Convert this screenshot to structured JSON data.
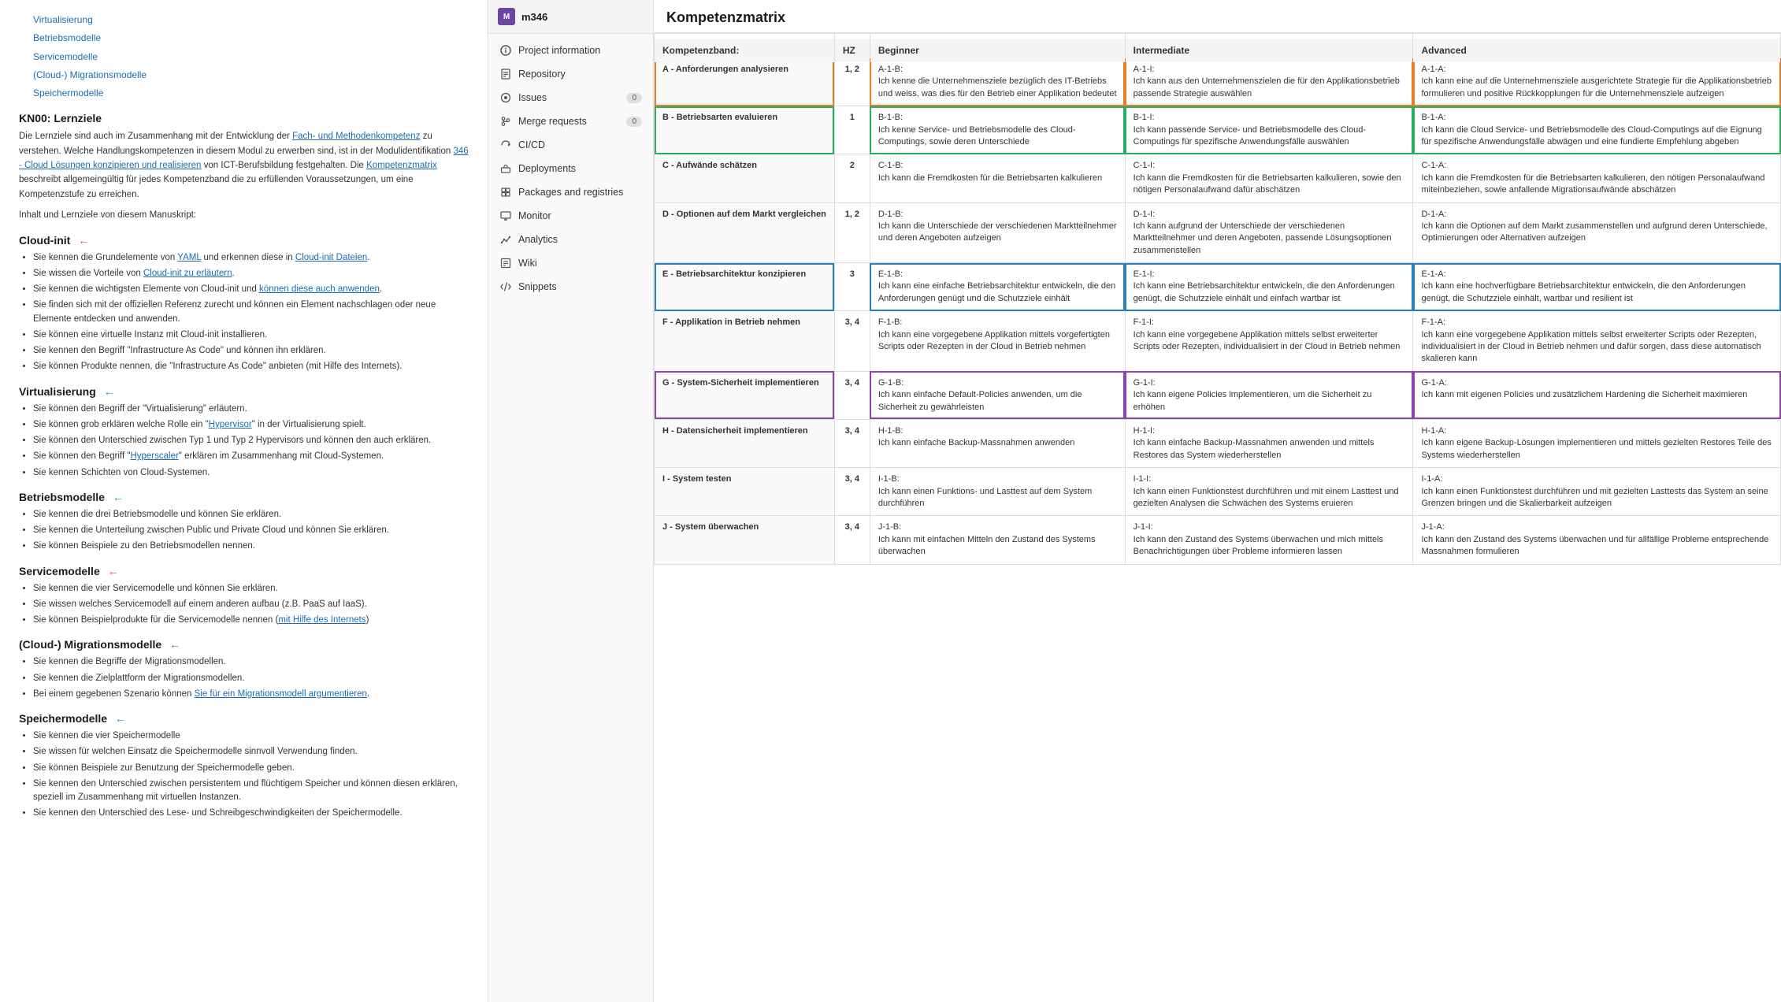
{
  "left_panel": {
    "toc": [
      {
        "label": "Virtualisierung"
      },
      {
        "label": "Betriebsmodelle"
      },
      {
        "label": "Servicemodelle"
      },
      {
        "label": "(Cloud-) Migrationsmodelle"
      },
      {
        "label": "Speichermodelle"
      }
    ],
    "sections": [
      {
        "id": "kn00",
        "title": "KN00: Lernziele",
        "intro": "Die Lernziele sind auch im Zusammenhang mit der Entwicklung der Fach- und Methodenkompetenz zu verstehen. Welche Handlungskompetenzen in diesem Modul zu erwerben sind, ist in der Modulidentifikation 346 - Cloud Lösungen konzipieren und realisieren von ICT-Berufsbildung festgehalten. Die Kompetenzmatrix beschreibt allgemeingültig für jedes Kompetenzband die zu erfüllenden Voraussetzungen, um eine Kompetenzstufe zu erreichen.",
        "subtext": "Inhalt und Lernziele von diesem Manuskript:"
      },
      {
        "id": "cloudinit",
        "title": "Cloud-init",
        "items": [
          "Sie kennen die Grundelemente von YAML und erkennen diese in Cloud-init Dateien.",
          "Sie wissen die Vorteile von Cloud-init zu erläutern.",
          "Sie kennen die wichtigsten Elemente von Cloud-init und können diese auch anwenden.",
          "Sie finden sich mit der offiziellen Referenz zurecht und können ein Element nachschlagen oder neue Elemente entdecken und anwenden.",
          "Sie können eine virtuelle Instanz mit Cloud-init installieren.",
          "Sie kennen den Begriff \"Infrastructure As Code\" und können ihn erklären.",
          "Sie können Produkte nennen, die \"Infrastructure As Code\" anbieten (mit Hilfe des Internets)."
        ]
      },
      {
        "id": "virtualisierung",
        "title": "Virtualisierung",
        "items": [
          "Sie können den Begriff der \"Virtualisierung\" erläutern.",
          "Sie können grob erklären welche Rolle ein \"Hypervisor\" in der Virtualisierung spielt.",
          "Sie können den Unterschied zwischen Typ 1 und Typ 2 Hypervisors und können den auch erklären.",
          "Sie können den Begriff \"Hyperscaler\" erklären im Zusammenhang mit Cloud-Systemen.",
          "Sie kennen Schichten von Cloud-Systemen."
        ]
      },
      {
        "id": "betriebsmodelle",
        "title": "Betriebsmodelle",
        "items": [
          "Sie kennen die drei Betriebsmodelle und können Sie erklären.",
          "Sie kennen die Unterteilung zwischen Public und Private Cloud und können Sie erklären.",
          "Sie können Beispiele zu den Betriebsmodellen nennen."
        ]
      },
      {
        "id": "servicemodelle",
        "title": "Servicemodelle",
        "items": [
          "Sie kennen die vier Servicemodelle und können Sie erklären.",
          "Sie wissen welches Servicemodell auf einem anderen aufbau (z.B. PaaS auf IaaS).",
          "Sie können Beispielprodukte für die Servicemodelle nennen (mit Hilfe des Internets)"
        ]
      },
      {
        "id": "migrationsmodelle",
        "title": "(Cloud-) Migrationsmodelle",
        "items": [
          "Sie kennen die Begriffe der Migrationsmodellen.",
          "Sie kennen die Zielplattform der Migrationsmodellen.",
          "Bei einem gegebenen Szenario können Sie für ein Migrationsmodell argumentieren."
        ]
      },
      {
        "id": "speichermodelle",
        "title": "Speichermodelle",
        "items": [
          "Sie kennen die vier Speichermodelle",
          "Sie wissen für welchen Einsatz die Speichermodelle sinnvoll Verwendung finden.",
          "Sie können Beispiele zur Benutzung der Speichermodelle geben.",
          "Sie kennen den Unterschied zwischen persistentem und flüchtigem Speicher und können diesen erklären, speziell im Zusammenhang mit virtuellen Instanzen.",
          "Sie kennen den Unterschied des Lese- und Schreibgeschwindigkeiten der Speichermodelle."
        ]
      }
    ]
  },
  "sidebar": {
    "project_icon": "M",
    "project_name": "m346",
    "items": [
      {
        "label": "Project information",
        "icon": "info",
        "active": false
      },
      {
        "label": "Repository",
        "icon": "repo",
        "active": false
      },
      {
        "label": "Issues",
        "icon": "issues",
        "active": false,
        "badge": "0"
      },
      {
        "label": "Merge requests",
        "icon": "merge",
        "active": false,
        "badge": "0"
      },
      {
        "label": "CI/CD",
        "icon": "cicd",
        "active": false
      },
      {
        "label": "Deployments",
        "icon": "deploy",
        "active": false
      },
      {
        "label": "Packages and registries",
        "icon": "packages",
        "active": false
      },
      {
        "label": "Monitor",
        "icon": "monitor",
        "active": false
      },
      {
        "label": "Analytics",
        "icon": "analytics",
        "active": false
      },
      {
        "label": "Wiki",
        "icon": "wiki",
        "active": false
      },
      {
        "label": "Snippets",
        "icon": "snippets",
        "active": false
      }
    ]
  },
  "matrix": {
    "title": "Kompetenzmatrix",
    "columns": [
      "Kompetenzband:",
      "HZ",
      "Beginner",
      "Intermediate",
      "Advanced"
    ],
    "rows": [
      {
        "band": "A - Anforderungen analysieren",
        "hz": "1, 2",
        "beginner": "A-1-B:\nIch kenne die Unternehmensziele bezüglich des IT-Betriebs und weiss, was dies für den Betrieb einer Applikation bedeutet",
        "intermediate": "A-1-I:\nIch kann aus den Unternehmenszielen die für den Applikationsbetrieb passende Strategie auswählen",
        "advanced": "A-1-A:\nIch kann eine auf die Unternehmensziele ausgerichtete Strategie für die Applikationsbetrieb formulieren und positive Rückkopplungen für die Unternehmensziele aufzeigen",
        "highlight": "orange"
      },
      {
        "band": "B - Betriebsarten evaluieren",
        "hz": "1",
        "beginner": "B-1-B:\nIch kenne Service- und Betriebsmodelle des Cloud-Computings, sowie deren Unterschiede",
        "intermediate": "B-1-I:\nIch kann passende Service- und Betriebsmodelle des Cloud-Computings für spezifische Anwendungsfälle auswählen",
        "advanced": "B-1-A:\nIch kann die Cloud Service- und Betriebsmodelle des Cloud-Computings auf die Eignung für spezifische Anwendungsfälle abwägen und eine fundierte Empfehlung abgeben",
        "highlight": "green"
      },
      {
        "band": "C - Aufwände schätzen",
        "hz": "2",
        "beginner": "C-1-B:\nIch kann die Fremdkosten für die Betriebsarten kalkulieren",
        "intermediate": "C-1-I:\nIch kann die Fremdkosten für die Betriebsarten kalkulieren, sowie den nötigen Personalaufwand dafür abschätzen",
        "advanced": "C-1-A:\nIch kann die Fremdkosten für die Betriebsarten kalkulieren, den nötigen Personalaufwand miteinbeziehen, sowie anfallende Migrationsaufwände abschätzen",
        "highlight": ""
      },
      {
        "band": "D - Optionen auf dem Markt vergleichen",
        "hz": "1, 2",
        "beginner": "D-1-B:\nIch kann die Unterschiede der verschiedenen Marktteilnehmer und deren Angeboten aufzeigen",
        "intermediate": "D-1-I:\nIch kann aufgrund der Unterschiede der verschiedenen Marktteilnehmer und deren Angeboten, passende Lösungsoptionen zusammenstellen",
        "advanced": "D-1-A:\nIch kann die Optionen auf dem Markt zusammenstellen und aufgrund deren Unterschiede, Optimierungen oder Alternativen aufzeigen",
        "highlight": ""
      },
      {
        "band": "E - Betriebsarchitektur konzipieren",
        "hz": "3",
        "beginner": "E-1-B:\nIch kann eine einfache Betriebsarchitektur entwickeln, die den Anforderungen genügt und die Schutzziele einhält",
        "intermediate": "E-1-I:\nIch kann eine Betriebsarchitektur entwickeln, die den Anforderungen genügt, die Schutzziele einhält und einfach wartbar ist",
        "advanced": "E-1-A:\nIch kann eine hochverfügbare Betriebsarchitektur entwickeln, die den Anforderungen genügt, die Schutzziele einhält, wartbar und resilient ist",
        "highlight": "blue"
      },
      {
        "band": "F - Applikation in Betrieb nehmen",
        "hz": "3, 4",
        "beginner": "F-1-B:\nIch kann eine vorgegebene Applikation mittels vorgefertigten Scripts oder Rezepten in der Cloud in Betrieb nehmen",
        "intermediate": "F-1-I:\nIch kann eine vorgegebene Applikation mittels selbst erweiterter Scripts oder Rezepten, individualisiert in der Cloud in Betrieb nehmen",
        "advanced": "F-1-A:\nIch kann eine vorgegebene Applikation mittels selbst erweiterter Scripts oder Rezepten, individualisiert in der Cloud in Betrieb nehmen und dafür sorgen, dass diese automatisch skalieren kann",
        "highlight": ""
      },
      {
        "band": "G - System-Sicherheit implementieren",
        "hz": "3, 4",
        "beginner": "G-1-B:\nIch kann einfache Default-Policies anwenden, um die Sicherheit zu gewährleisten",
        "intermediate": "G-1-I:\nIch kann eigene Policies implementieren, um die Sicherheit zu erhöhen",
        "advanced": "G-1-A:\nIch kann mit eigenen Policies und zusätzlichem Hardening die Sicherheit maximieren",
        "highlight": "purple"
      },
      {
        "band": "H - Datensicherheit implementieren",
        "hz": "3, 4",
        "beginner": "H-1-B:\nIch kann einfache Backup-Massnahmen anwenden",
        "intermediate": "H-1-I:\nIch kann einfache Backup-Massnahmen anwenden und mittels Restores das System wiederherstellen",
        "advanced": "H-1-A:\nIch kann eigene Backup-Lösungen implementieren und mittels gezielten Restores Teile des Systems wiederherstellen",
        "highlight": ""
      },
      {
        "band": "I - System testen",
        "hz": "3, 4",
        "beginner": "I-1-B:\nIch kann einen Funktions- und Lasttest auf dem System durchführen",
        "intermediate": "I-1-I:\nIch kann einen Funktionstest durchführen und mit einem Lasttest und gezielten Analysen die Schwächen des Systems eruieren",
        "advanced": "I-1-A:\nIch kann einen Funktionstest durchführen und mit gezielten Lasttests das System an seine Grenzen bringen und die Skalierbarkeit aufzeigen",
        "highlight": ""
      },
      {
        "band": "J - System überwachen",
        "hz": "3, 4",
        "beginner": "J-1-B:\nIch kann mit einfachen Mitteln den Zustand des Systems überwachen",
        "intermediate": "J-1-I:\nIch kann den Zustand des Systems überwachen und mich mittels Benachrichtigungen über Probleme informieren lassen",
        "advanced": "J-1-A:\nIch kann den Zustand des Systems überwachen und für allfällige Probleme entsprechende Massnahmen formulieren",
        "highlight": ""
      }
    ]
  },
  "colors": {
    "orange": "#e67e22",
    "green": "#27ae60",
    "blue": "#2980b9",
    "purple": "#8e44ad",
    "sidebar_bg": "#f9f9f9",
    "header_bg": "#f5f5f5",
    "project_icon_bg": "#6c47a0"
  }
}
